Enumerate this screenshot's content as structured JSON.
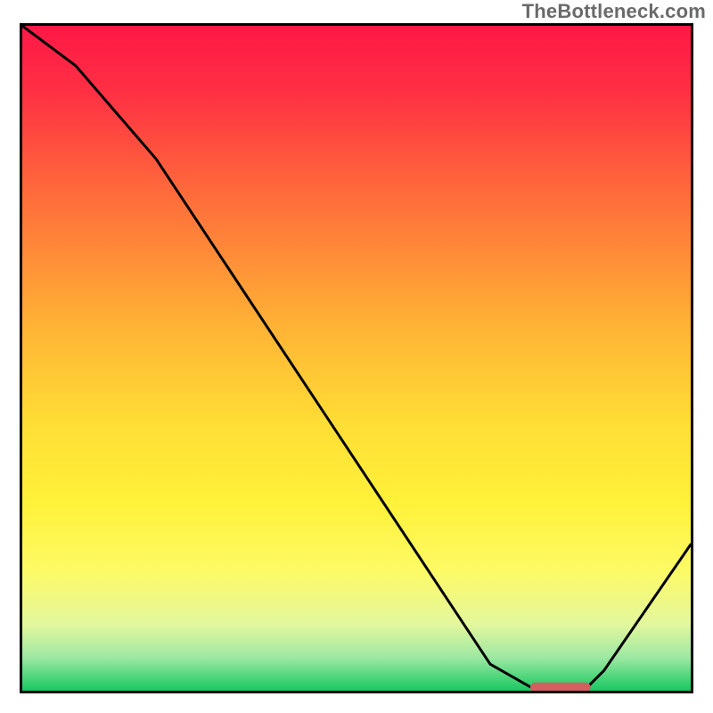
{
  "watermark": "TheBottleneck.com",
  "chart_data": {
    "type": "line",
    "title": "",
    "xlabel": "",
    "ylabel": "",
    "xlim": [
      0,
      100
    ],
    "ylim": [
      0,
      100
    ],
    "series": [
      {
        "name": "curve",
        "x": [
          0,
          8,
          20,
          70,
          77,
          84,
          87,
          100
        ],
        "values": [
          100,
          94,
          80,
          4,
          0,
          0,
          3,
          22
        ]
      }
    ],
    "marker": {
      "name": "marker-bar",
      "x_start": 76,
      "x_end": 85,
      "y": 0.5,
      "color": "#d1605e"
    },
    "gradient_stops": [
      {
        "offset": 0.0,
        "color": "#ff1846"
      },
      {
        "offset": 0.1,
        "color": "#ff3044"
      },
      {
        "offset": 0.25,
        "color": "#ff6a3b"
      },
      {
        "offset": 0.45,
        "color": "#ffb235"
      },
      {
        "offset": 0.6,
        "color": "#ffde35"
      },
      {
        "offset": 0.72,
        "color": "#fff23a"
      },
      {
        "offset": 0.82,
        "color": "#fdfa66"
      },
      {
        "offset": 0.9,
        "color": "#e3f79d"
      },
      {
        "offset": 0.95,
        "color": "#9de8a3"
      },
      {
        "offset": 1.0,
        "color": "#18c860"
      }
    ]
  }
}
